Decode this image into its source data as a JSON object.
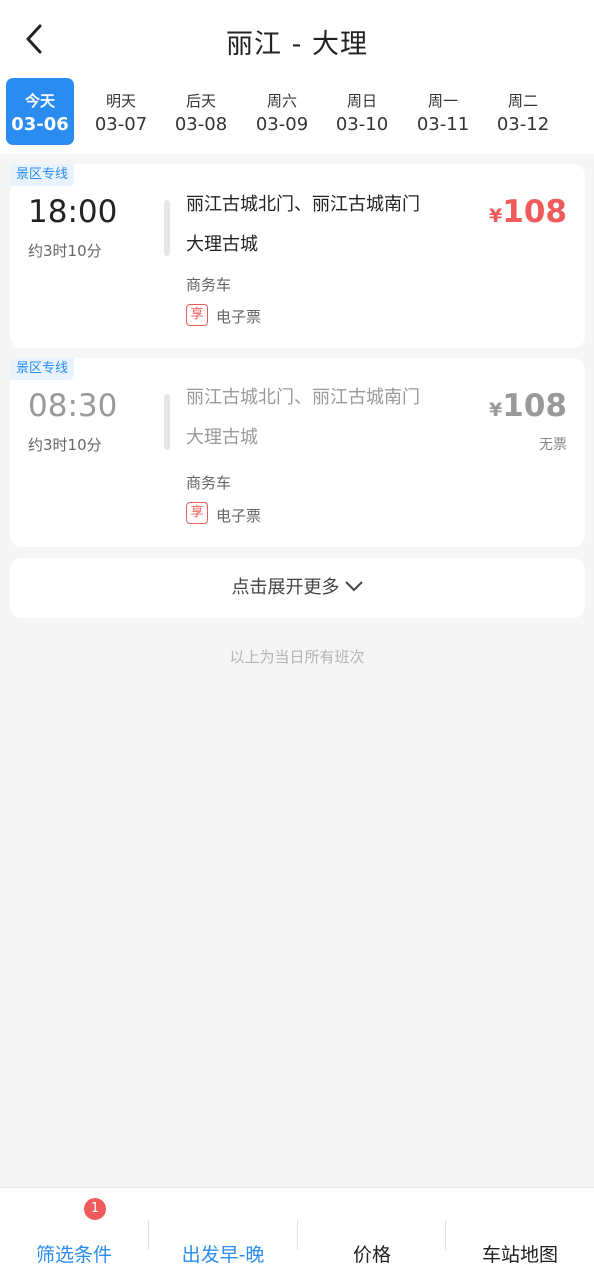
{
  "header": {
    "title": "丽江 - 大理"
  },
  "dates": [
    {
      "label": "今天",
      "date": "03-06",
      "active": true
    },
    {
      "label": "明天",
      "date": "03-07"
    },
    {
      "label": "后天",
      "date": "03-08"
    },
    {
      "label": "周六",
      "date": "03-09"
    },
    {
      "label": "周日",
      "date": "03-10"
    },
    {
      "label": "周一",
      "date": "03-11"
    },
    {
      "label": "周二",
      "date": "03-12"
    }
  ],
  "trips": [
    {
      "tag": "景区专线",
      "time": "18:00",
      "duration": "约3时10分",
      "from": "丽江古城北门、丽江古城南门",
      "to": "大理古城",
      "vehicle": "商务车",
      "perk": "享",
      "ticket": "电子票",
      "currency": "¥",
      "price": "108",
      "status": ""
    },
    {
      "tag": "景区专线",
      "time": "08:30",
      "duration": "约3时10分",
      "from": "丽江古城北门、丽江古城南门",
      "to": "大理古城",
      "vehicle": "商务车",
      "perk": "享",
      "ticket": "电子票",
      "currency": "¥",
      "price": "108",
      "status": "无票"
    }
  ],
  "expand": {
    "label": "点击展开更多"
  },
  "end_note": "以上为当日所有班次",
  "bottom": {
    "filter": "筛选条件",
    "filter_badge": "1",
    "depart_sort": "出发早-晚",
    "price_sort": "价格",
    "station_map": "车站地图"
  },
  "colors": {
    "accent": "#2a8cf0",
    "price": "#f05a5a"
  }
}
